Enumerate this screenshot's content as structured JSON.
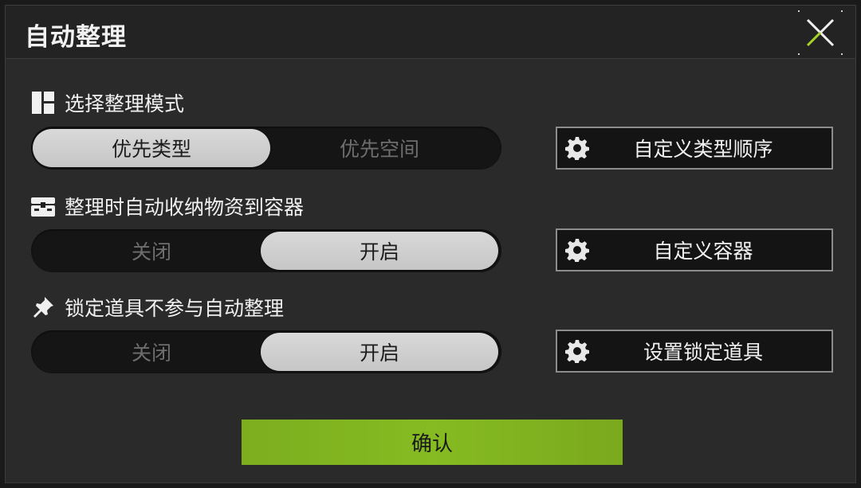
{
  "dialog": {
    "title": "自动整理",
    "close_icon": "close-icon"
  },
  "sections": [
    {
      "label": "选择整理模式",
      "icon": "layout-icon",
      "options": [
        "优先类型",
        "优先空间"
      ],
      "selected": "优先类型",
      "action_label": "自定义类型顺序"
    },
    {
      "label": "整理时自动收纳物资到容器",
      "icon": "chest-icon",
      "options": [
        "关闭",
        "开启"
      ],
      "selected": "开启",
      "action_label": "自定义容器"
    },
    {
      "label": "锁定道具不参与自动整理",
      "icon": "pin-icon",
      "options": [
        "关闭",
        "开启"
      ],
      "selected": "开启",
      "action_label": "设置锁定道具"
    }
  ],
  "confirm_label": "确认",
  "colors": {
    "accent_green": "#84b820",
    "active_toggle": "#d0d0d0",
    "panel": "#2a2a2a"
  }
}
